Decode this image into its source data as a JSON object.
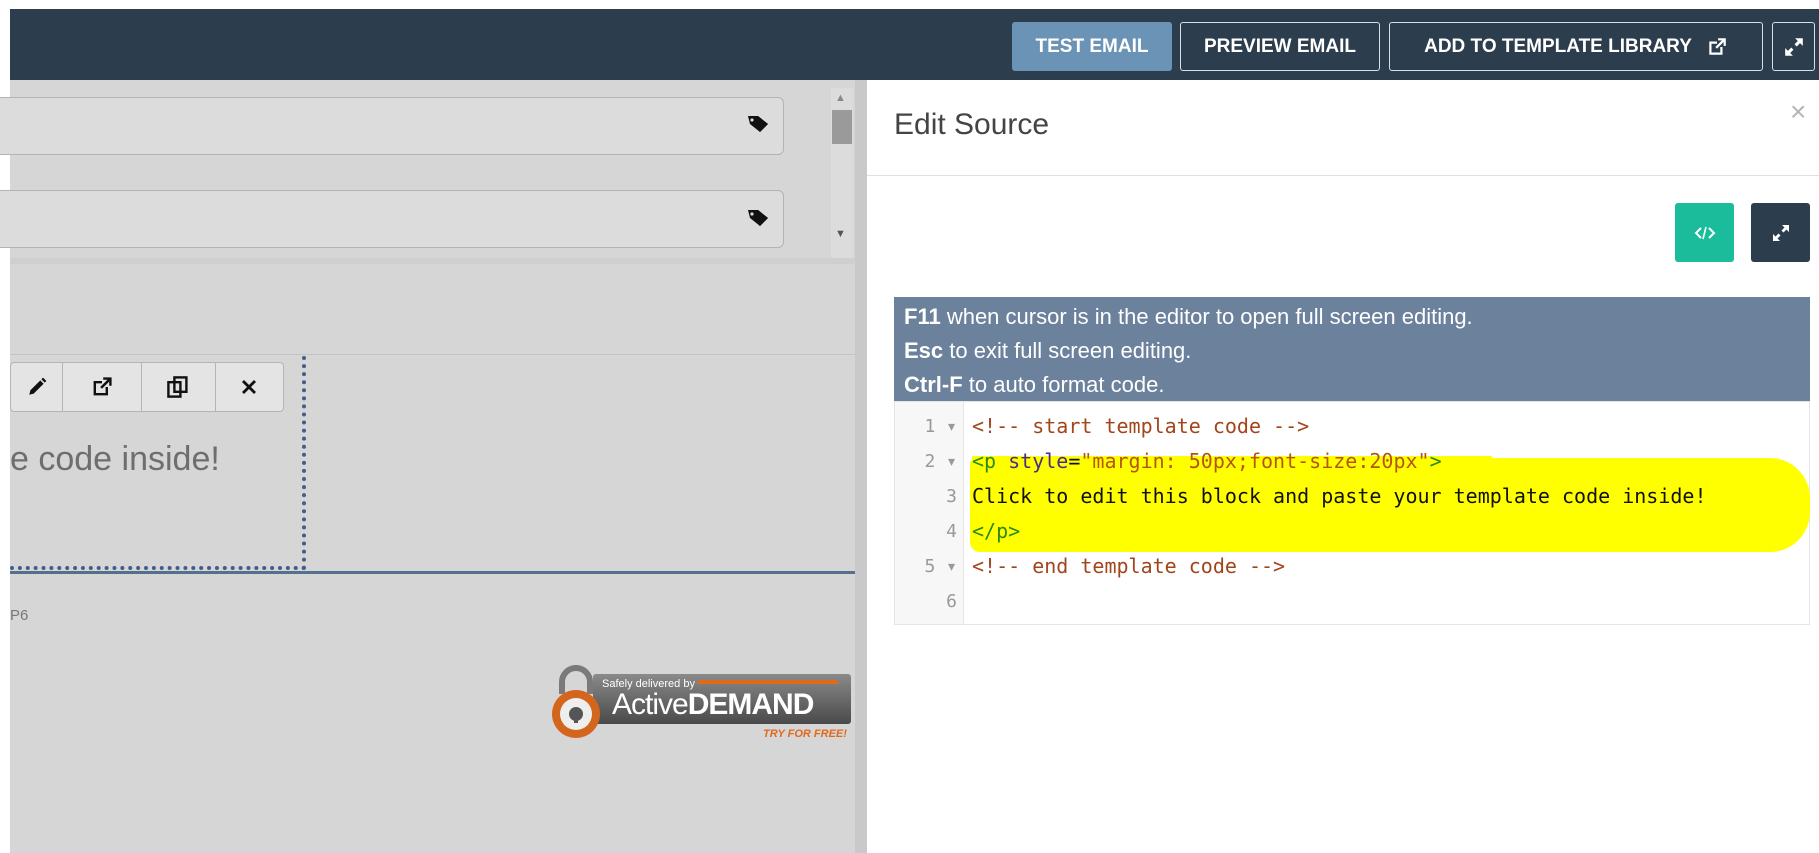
{
  "topbar": {
    "test_email": "TEST EMAIL",
    "preview_email": "PREVIEW EMAIL",
    "add_to_library": "ADD TO TEMPLATE LIBRARY",
    "accent": "#6b93b6",
    "bar_color": "#2c3e4e"
  },
  "left": {
    "block_text": "e code inside!",
    "footer_code": "P6",
    "badge": {
      "line1": "Safely delivered by",
      "brand_a": "Active",
      "brand_b": "DEMAND",
      "cta": "TRY FOR FREE!"
    },
    "toolbar_icons": [
      "pencil-icon",
      "external-link-icon",
      "duplicate-icon",
      "close-icon"
    ]
  },
  "panel": {
    "title": "Edit Source",
    "close": "×",
    "info": [
      {
        "key": "F11",
        "text": " when cursor is in the editor to open full screen editing."
      },
      {
        "key": "Esc",
        "text": " to exit full screen editing."
      },
      {
        "key": "Ctrl-F",
        "text": " to auto format code."
      }
    ],
    "code_lines": [
      {
        "n": "1",
        "fold": "▾",
        "parts": [
          {
            "t": "<!-- start template code -->",
            "c": "c-comment"
          }
        ]
      },
      {
        "n": "2",
        "fold": "▾",
        "parts": [
          {
            "t": "<p",
            "c": "c-tag"
          },
          {
            "t": " style",
            "c": "c-attr"
          },
          {
            "t": "=",
            "c": "c-text"
          },
          {
            "t": "\"margin: 50px;font-size:20px\"",
            "c": "c-str"
          },
          {
            "t": ">",
            "c": "c-tag"
          }
        ]
      },
      {
        "n": "3",
        "fold": "",
        "parts": [
          {
            "t": "Click to edit this block and paste your template code inside!",
            "c": "c-text"
          }
        ]
      },
      {
        "n": "4",
        "fold": "",
        "parts": [
          {
            "t": "</p>",
            "c": "c-tag"
          }
        ]
      },
      {
        "n": "5",
        "fold": "▾",
        "parts": [
          {
            "t": "<!-- end template code -->",
            "c": "c-comment"
          }
        ]
      },
      {
        "n": "6",
        "fold": "",
        "parts": []
      }
    ],
    "btn_green": "#1abc9c",
    "btn_dark": "#2c3e4e"
  }
}
